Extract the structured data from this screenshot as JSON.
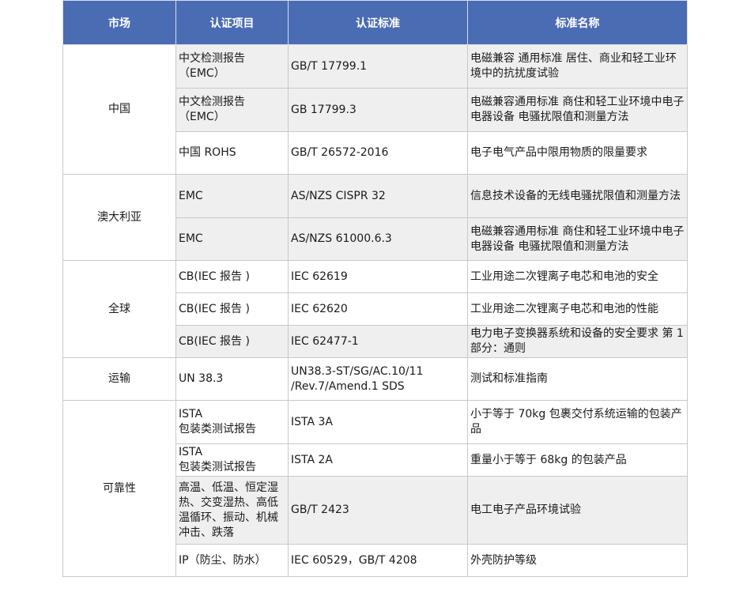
{
  "colors": {
    "header_bg": "#4a6cb3",
    "header_text": "#ffffff",
    "row_shade": "#efefef",
    "border": "#c9c9c9"
  },
  "headers": [
    "市场",
    "认证项目",
    "认证标准",
    "标准名称"
  ],
  "groups": [
    {
      "market": "中国",
      "rows": [
        {
          "item": "中文检测报告\n（EMC）",
          "standard": "GB/T 17799.1",
          "name": "电磁兼容 通用标准 居住、商业和轻工业环境中的抗扰度试验"
        },
        {
          "item": "中文检测报告\n（EMC）",
          "standard": "GB 17799.3",
          "name": "电磁兼容通用标准 商住和轻工业环境中电子电器设备 电骚扰限值和测量方法"
        },
        {
          "item": "中国 ROHS",
          "standard": "GB/T 26572-2016",
          "name": "电子电气产品中限用物质的限量要求"
        }
      ]
    },
    {
      "market": "澳大利亚",
      "rows": [
        {
          "item": "EMC",
          "standard": "AS/NZS CISPR 32",
          "name": "信息技术设备的无线电骚扰限值和测量方法"
        },
        {
          "item": "EMC",
          "standard": "AS/NZS 61000.6.3",
          "name": "电磁兼容通用标准 商住和轻工业环境中电子电器设备 电骚扰限值和测量方法"
        }
      ]
    },
    {
      "market": "全球",
      "rows": [
        {
          "item": "CB(IEC 报告 )",
          "standard": "IEC 62619",
          "name": "工业用途二次锂离子电芯和电池的安全"
        },
        {
          "item": "CB(IEC 报告 )",
          "standard": "IEC 62620",
          "name": "工业用途二次锂离子电芯和电池的性能"
        },
        {
          "item": "CB(IEC 报告 )",
          "standard": "IEC 62477-1",
          "name": "电力电子变换器系统和设备的安全要求 第 1 部分：通则"
        }
      ]
    },
    {
      "market": "运输",
      "rows": [
        {
          "item": "UN 38.3",
          "standard": "UN38.3-ST/SG/AC.10/11\n/Rev.7/Amend.1 SDS",
          "name": "测试和标准指南"
        }
      ]
    },
    {
      "market": "可靠性",
      "rows": [
        {
          "item": "ISTA\n包装类测试报告",
          "standard": "ISTA 3A",
          "name": "小于等于 70kg 包裹交付系统运输的包装产品"
        },
        {
          "item": "ISTA\n包装类测试报告",
          "standard": "ISTA 2A",
          "name": "重量小于等于 68kg 的包装产品"
        },
        {
          "item": "高温、低温、恒定湿热、交变湿热、高低温循环、振动、机械冲击、跌落",
          "standard": "GB/T 2423",
          "name": "电工电子产品环境试验"
        },
        {
          "item": "IP（防尘、防水）",
          "standard": "IEC 60529，GB/T 4208",
          "name": "外壳防护等级"
        }
      ]
    }
  ]
}
